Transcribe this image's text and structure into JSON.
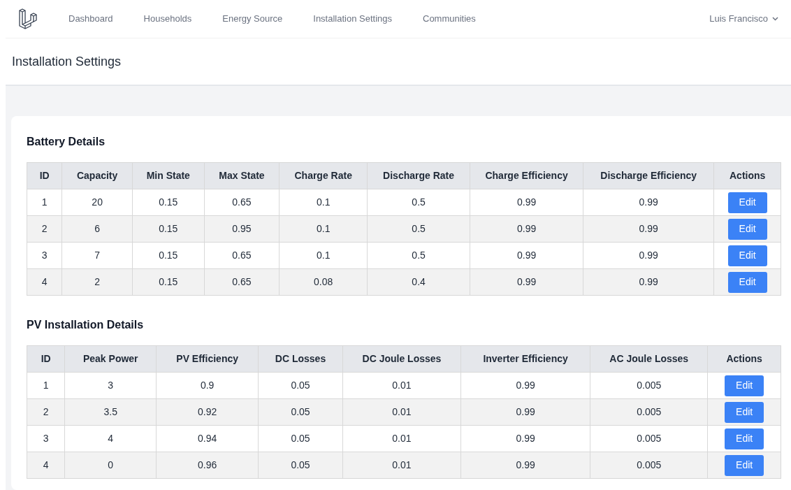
{
  "nav": {
    "items": [
      "Dashboard",
      "Households",
      "Energy Source",
      "Installation Settings",
      "Communities"
    ],
    "user": "Luis Francisco"
  },
  "page_title": "Installation Settings",
  "sections": [
    {
      "title": "Battery Details",
      "columns": [
        "ID",
        "Capacity",
        "Min State",
        "Max State",
        "Charge Rate",
        "Discharge Rate",
        "Charge Efficiency",
        "Discharge Efficiency",
        "Actions"
      ],
      "rows": [
        {
          "cells": [
            "1",
            "20",
            "0.15",
            "0.65",
            "0.1",
            "0.5",
            "0.99",
            "0.99"
          ],
          "action": "Edit"
        },
        {
          "cells": [
            "2",
            "6",
            "0.15",
            "0.95",
            "0.1",
            "0.5",
            "0.99",
            "0.99"
          ],
          "action": "Edit"
        },
        {
          "cells": [
            "3",
            "7",
            "0.15",
            "0.65",
            "0.1",
            "0.5",
            "0.99",
            "0.99"
          ],
          "action": "Edit"
        },
        {
          "cells": [
            "4",
            "2",
            "0.15",
            "0.65",
            "0.08",
            "0.4",
            "0.99",
            "0.99"
          ],
          "action": "Edit"
        }
      ]
    },
    {
      "title": "PV Installation Details",
      "columns": [
        "ID",
        "Peak Power",
        "PV Efficiency",
        "DC Losses",
        "DC Joule Losses",
        "Inverter Efficiency",
        "AC Joule Losses",
        "Actions"
      ],
      "rows": [
        {
          "cells": [
            "1",
            "3",
            "0.9",
            "0.05",
            "0.01",
            "0.99",
            "0.005"
          ],
          "action": "Edit"
        },
        {
          "cells": [
            "2",
            "3.5",
            "0.92",
            "0.05",
            "0.01",
            "0.99",
            "0.005"
          ],
          "action": "Edit"
        },
        {
          "cells": [
            "3",
            "4",
            "0.94",
            "0.05",
            "0.01",
            "0.99",
            "0.005"
          ],
          "action": "Edit"
        },
        {
          "cells": [
            "4",
            "0",
            "0.96",
            "0.05",
            "0.01",
            "0.99",
            "0.005"
          ],
          "action": "Edit"
        }
      ]
    }
  ]
}
